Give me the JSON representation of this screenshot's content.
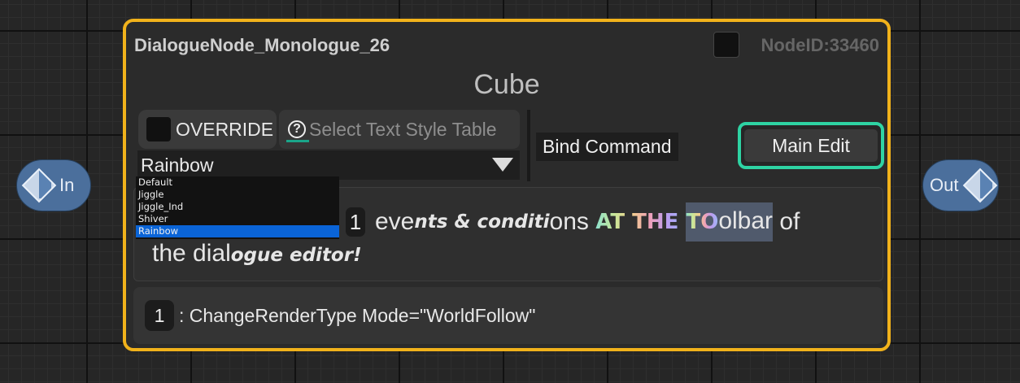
{
  "pins": {
    "in_label": "In",
    "out_label": "Out"
  },
  "node": {
    "title": "DialogueNode_Monologue_26",
    "node_id": "NodeID:33460",
    "speaker": "Cube",
    "override_label": "OVERRIDE",
    "style_table_placeholder": "Select Text Style Table",
    "selected_style": "Rainbow",
    "bind_command_label": "Bind Command",
    "main_edit_label": "Main Edit",
    "dialogue": {
      "marker": "1",
      "seg1": "eve",
      "seg2": "nts & conditi",
      "seg3": "ons ",
      "seg4": "AT THE ",
      "seg5": "TO",
      "seg6": "olbar",
      "seg7": " of",
      "line2_a": "the dial",
      "line2_b": "ogue editor!"
    },
    "event": {
      "badge": "1",
      "text": ": ChangeRenderType Mode=\"WorldFollow\""
    }
  },
  "dropdown": {
    "options": [
      "Default",
      "Jiggle",
      "Jiggle_Ind",
      "Shiver",
      "Rainbow"
    ],
    "selected_index": 4
  },
  "colors": {
    "node_border": "#f1b21b",
    "main_edit_border": "#2ed3a3",
    "pin": "#4b6f9c",
    "dropdown_selected": "#0a64d7"
  }
}
